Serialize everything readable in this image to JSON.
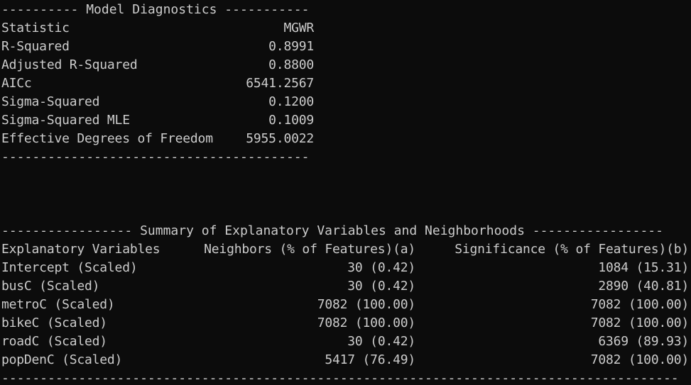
{
  "diagnostics": {
    "header_rule": "---------- Model Diagnostics -----------",
    "col_header": {
      "label": "Statistic",
      "value": "MGWR"
    },
    "rows": [
      {
        "label": "R-Squared",
        "value": "0.8991"
      },
      {
        "label": "Adjusted R-Squared",
        "value": "0.8800"
      },
      {
        "label": "AICc",
        "value": "6541.2567"
      },
      {
        "label": "Sigma-Squared",
        "value": "0.1200"
      },
      {
        "label": "Sigma-Squared MLE",
        "value": "0.1009"
      },
      {
        "label": "Effective Degrees of Freedom",
        "value": "5955.0022"
      }
    ],
    "footer_rule": "----------------------------------------"
  },
  "summary": {
    "header_rule": "----------------- Summary of Explanatory Variables and Neighborhoods -----------------",
    "headers": {
      "variable": "Explanatory Variables",
      "neighbors": "Neighbors (% of Features)(a)",
      "significance": "Significance (% of Features)(b)"
    },
    "rows": [
      {
        "variable": "Intercept (Scaled)",
        "neighbors": "30 (0.42)",
        "significance": "1084 (15.31)"
      },
      {
        "variable": "busC (Scaled)",
        "neighbors": "30 (0.42)",
        "significance": "2890 (40.81)"
      },
      {
        "variable": "metroC (Scaled)",
        "neighbors": "7082 (100.00)",
        "significance": "7082 (100.00)"
      },
      {
        "variable": "bikeC (Scaled)",
        "neighbors": "7082 (100.00)",
        "significance": "7082 (100.00)"
      },
      {
        "variable": "roadC (Scaled)",
        "neighbors": "30 (0.42)",
        "significance": "6369 (89.93)"
      },
      {
        "variable": "popDenC (Scaled)",
        "neighbors": "5417 (76.49)",
        "significance": "7082 (100.00)"
      }
    ],
    "footer_rule": "----------------------------------------------------------------------------------------"
  }
}
